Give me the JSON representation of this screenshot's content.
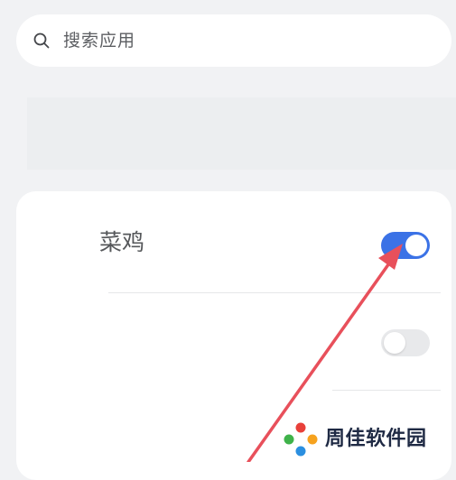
{
  "search": {
    "placeholder": "搜索应用",
    "icon": "search-icon"
  },
  "app_list": {
    "items": [
      {
        "name": "菜鸡",
        "enabled": true
      },
      {
        "name": "",
        "enabled": false
      }
    ]
  },
  "colors": {
    "toggle_on": "#3b72e6",
    "toggle_off": "#e8e9eb",
    "annotation_arrow": "#e8505b"
  },
  "watermark": {
    "text": "周佳软件园"
  }
}
